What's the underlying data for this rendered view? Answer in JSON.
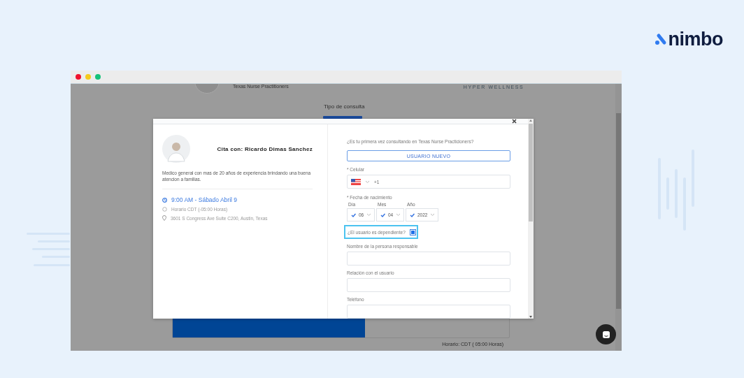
{
  "brand": {
    "name": "nimbo"
  },
  "browser": {
    "background_page": {
      "clinic_name": "Texas Nurse Practitioners",
      "partner": "HYPER WELLNESS",
      "section_title": "Tipo de consulta",
      "timezone_note": "Horario: CDT ( 05:00 Horas)"
    }
  },
  "modal": {
    "doctor": {
      "title": "Cita con: Ricardo Dimas Sanchez",
      "bio": "Medico general con mas de 20 años de experiencia brindando una buena atencion a familias.",
      "time": "9:00 AM - Sábado Abril 9",
      "timezone": "Horario CDT (-05:00 Horas)",
      "address": "3601 S Congress Ave Suite C200, Austin, Texas"
    },
    "form": {
      "first_time_question": "¿Es tu primera vez consultando en Texas Nurse Practicioners?",
      "new_user_button": "USUARIO NUEVO",
      "phone": {
        "label": "* Celular",
        "prefix": "+1"
      },
      "birth_date": {
        "label": "* Fecha de nacimiento",
        "parts": [
          {
            "label": "Día",
            "value": "06"
          },
          {
            "label": "Mes",
            "value": "04"
          },
          {
            "label": "Año",
            "value": "2022"
          }
        ]
      },
      "dependent": {
        "label": "¿El usuario es dependiente?",
        "checked": true
      },
      "fields": [
        {
          "label": "Nombre de la persona responsable"
        },
        {
          "label": "Relación con el usuario"
        },
        {
          "label": "Teléfono"
        }
      ]
    }
  }
}
